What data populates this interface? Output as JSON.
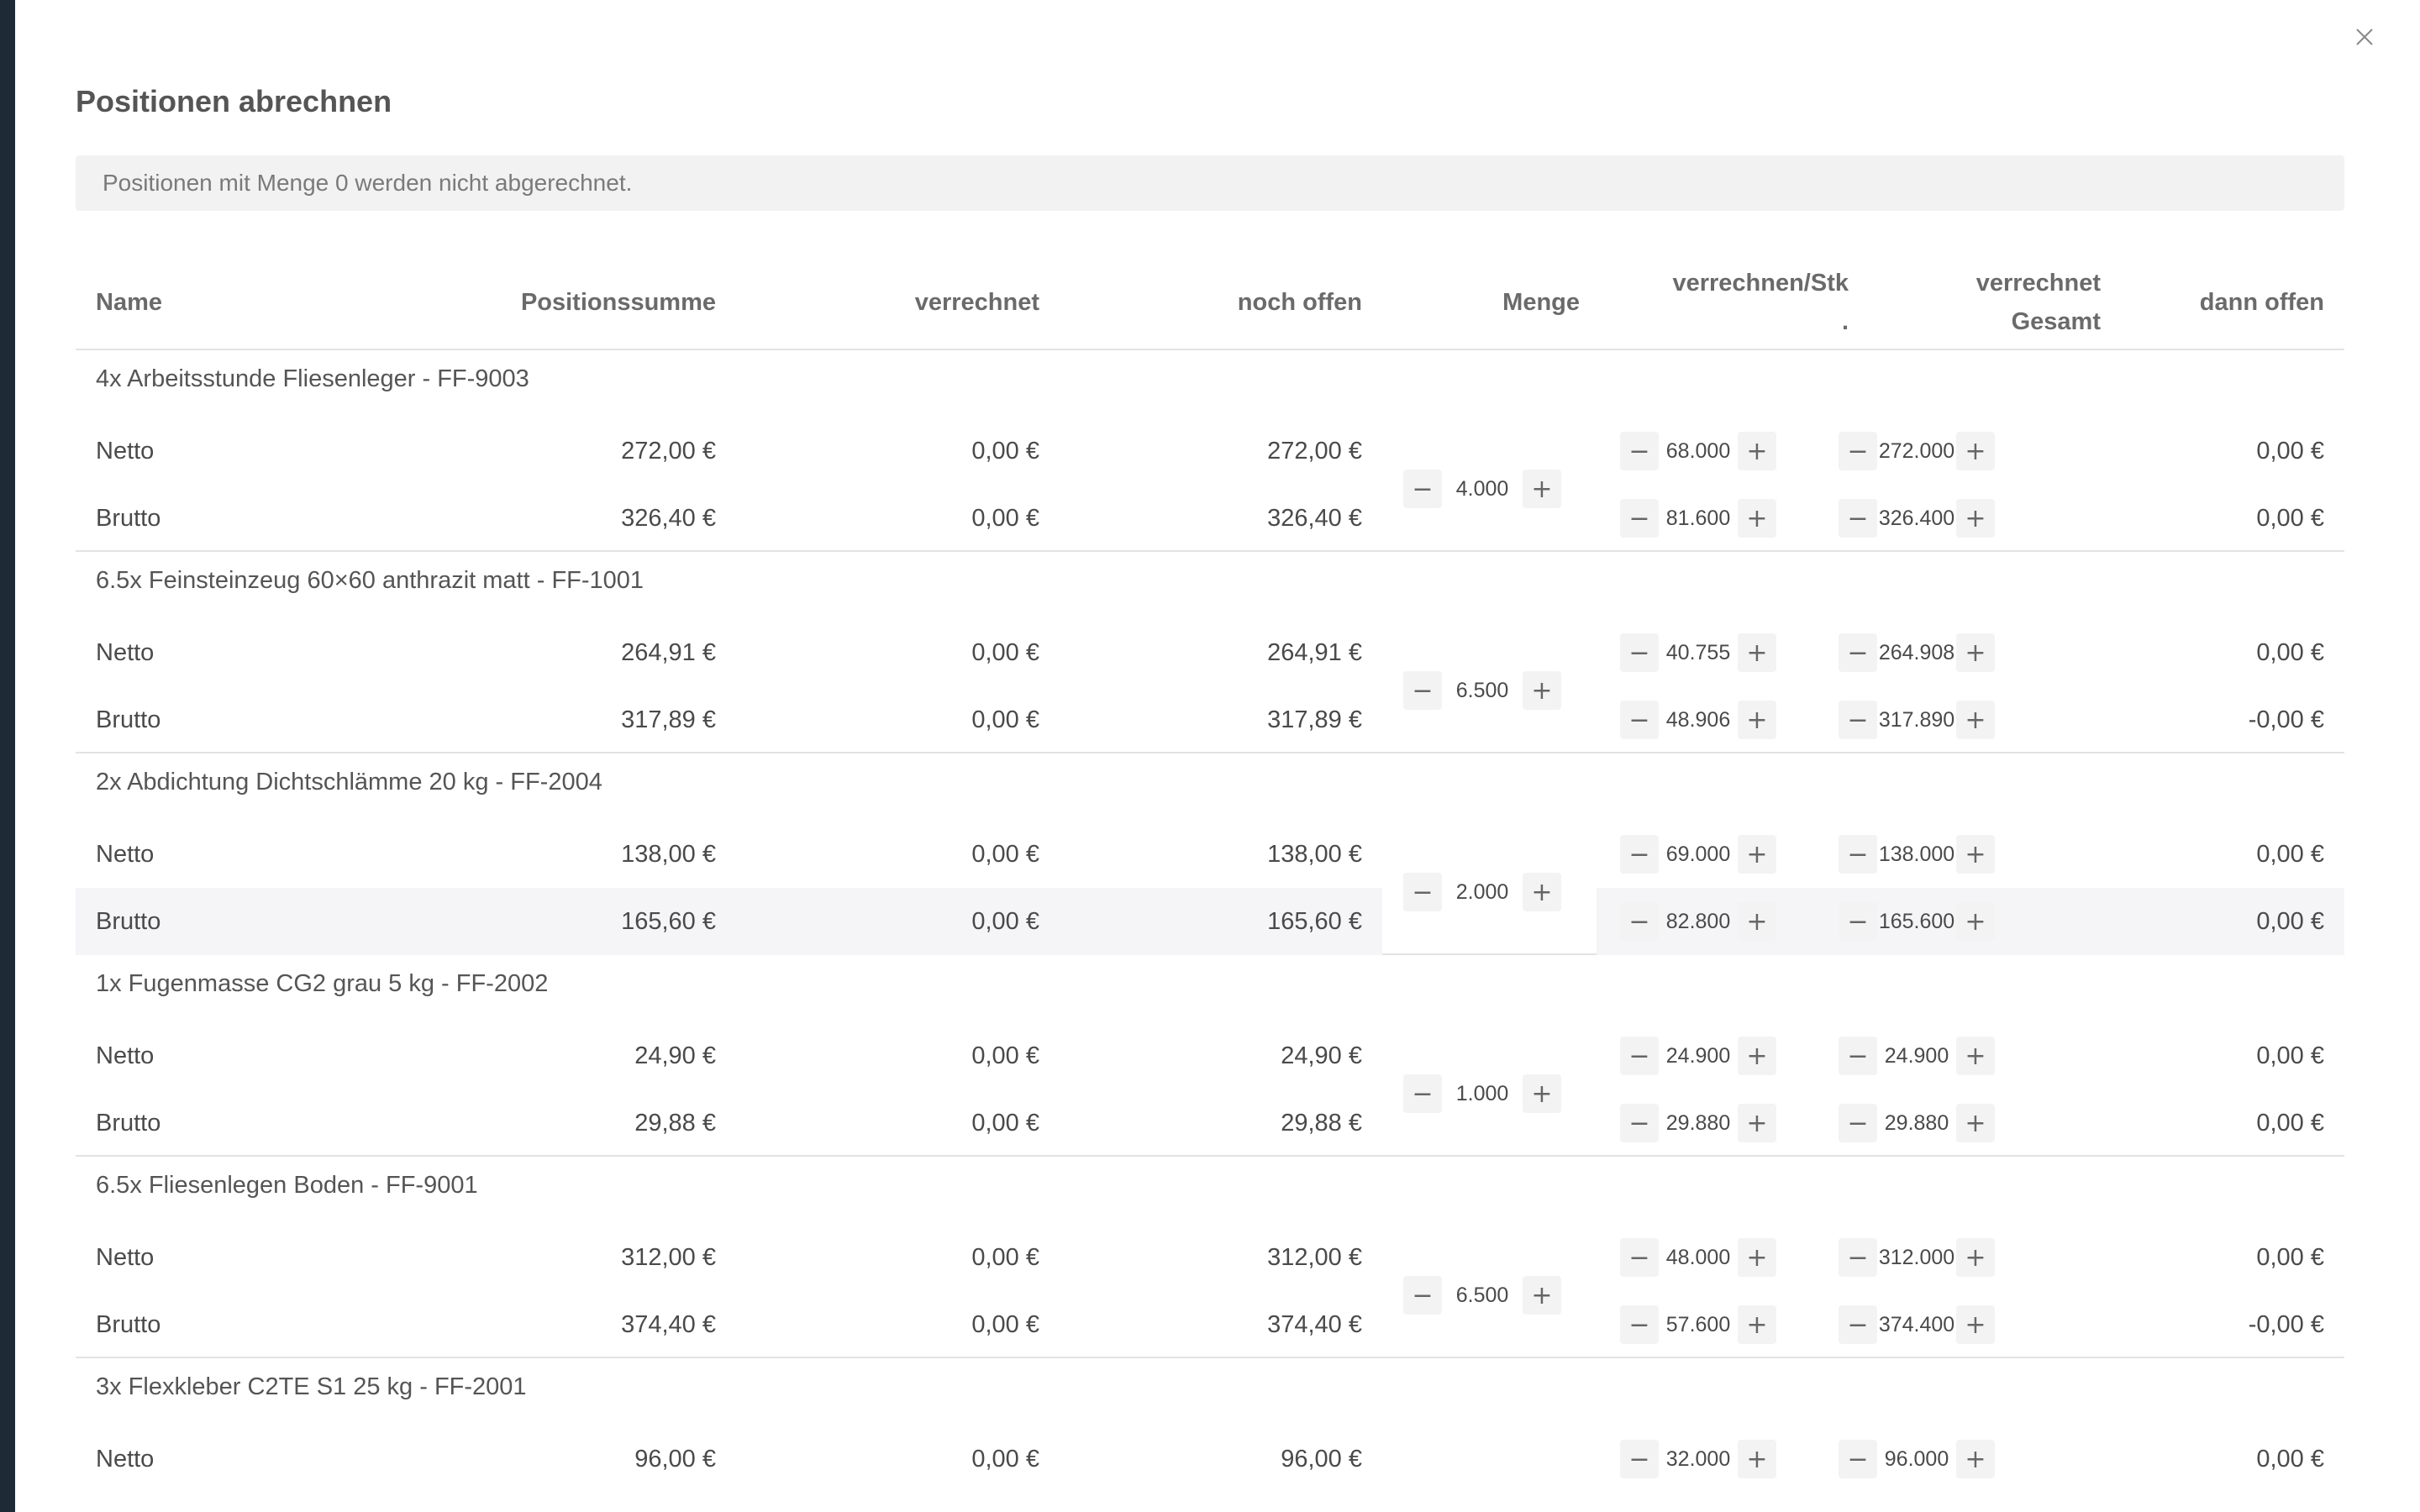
{
  "dialog": {
    "title": "Positionen abrechnen",
    "notice": "Positionen mit Menge 0 werden nicht abgerechnet.",
    "close_icon": "close-icon"
  },
  "table": {
    "headers": {
      "name": "Name",
      "positionssumme": "Positionssumme",
      "verrechnet": "verrechnet",
      "noch_offen": "noch offen",
      "menge": "Menge",
      "verrechnen_stk_line1": "verrechnen/Stk",
      "verrechnen_stk_line2": ".",
      "verrechnet_gesamt_line1": "verrechnet",
      "verrechnet_gesamt_line2": "Gesamt",
      "dann_offen": "dann offen"
    },
    "groups": [
      {
        "title": "4x Arbeitsstunde Fliesenleger - FF-9003",
        "menge": "4.000",
        "netto": {
          "label": "Netto",
          "positionssumme": "272,00 €",
          "verrechnet": "0,00 €",
          "noch_offen": "272,00 €",
          "per_stk": "68.000",
          "gesamt": "272.000",
          "dann_offen": "0,00 €"
        },
        "brutto": {
          "label": "Brutto",
          "positionssumme": "326,40 €",
          "verrechnet": "0,00 €",
          "noch_offen": "326,40 €",
          "per_stk": "81.600",
          "gesamt": "326.400",
          "dann_offen": "0,00 €"
        }
      },
      {
        "title": "6.5x Feinsteinzeug 60×60 anthrazit matt - FF-1001",
        "menge": "6.500",
        "netto": {
          "label": "Netto",
          "positionssumme": "264,91 €",
          "verrechnet": "0,00 €",
          "noch_offen": "264,91 €",
          "per_stk": "40.755",
          "gesamt": "264.908",
          "dann_offen": "0,00 €"
        },
        "brutto": {
          "label": "Brutto",
          "positionssumme": "317,89 €",
          "verrechnet": "0,00 €",
          "noch_offen": "317,89 €",
          "per_stk": "48.906",
          "gesamt": "317.890",
          "dann_offen": "-0,00 €"
        }
      },
      {
        "title": "2x Abdichtung Dichtschlämme 20 kg - FF-2004",
        "menge": "2.000",
        "netto": {
          "label": "Netto",
          "positionssumme": "138,00 €",
          "verrechnet": "0,00 €",
          "noch_offen": "138,00 €",
          "per_stk": "69.000",
          "gesamt": "138.000",
          "dann_offen": "0,00 €"
        },
        "brutto": {
          "label": "Brutto",
          "positionssumme": "165,60 €",
          "verrechnet": "0,00 €",
          "noch_offen": "165,60 €",
          "per_stk": "82.800",
          "gesamt": "165.600",
          "dann_offen": "0,00 €"
        }
      },
      {
        "title": "1x Fugenmasse CG2 grau 5 kg - FF-2002",
        "menge": "1.000",
        "netto": {
          "label": "Netto",
          "positionssumme": "24,90 €",
          "verrechnet": "0,00 €",
          "noch_offen": "24,90 €",
          "per_stk": "24.900",
          "gesamt": "24.900",
          "dann_offen": "0,00 €"
        },
        "brutto": {
          "label": "Brutto",
          "positionssumme": "29,88 €",
          "verrechnet": "0,00 €",
          "noch_offen": "29,88 €",
          "per_stk": "29.880",
          "gesamt": "29.880",
          "dann_offen": "0,00 €"
        }
      },
      {
        "title": "6.5x Fliesenlegen Boden - FF-9001",
        "menge": "6.500",
        "netto": {
          "label": "Netto",
          "positionssumme": "312,00 €",
          "verrechnet": "0,00 €",
          "noch_offen": "312,00 €",
          "per_stk": "48.000",
          "gesamt": "312.000",
          "dann_offen": "0,00 €"
        },
        "brutto": {
          "label": "Brutto",
          "positionssumme": "374,40 €",
          "verrechnet": "0,00 €",
          "noch_offen": "374,40 €",
          "per_stk": "57.600",
          "gesamt": "374.400",
          "dann_offen": "-0,00 €"
        }
      },
      {
        "title": "3x Flexkleber C2TE S1 25 kg - FF-2001",
        "menge": "",
        "netto": {
          "label": "Netto",
          "positionssumme": "96,00 €",
          "verrechnet": "0,00 €",
          "noch_offen": "96,00 €",
          "per_stk": "32.000",
          "gesamt": "96.000",
          "dann_offen": "0,00 €"
        },
        "brutto": {
          "label": "",
          "positionssumme": "",
          "verrechnet": "",
          "noch_offen": "",
          "per_stk": "",
          "gesamt": "",
          "dann_offen": ""
        }
      }
    ]
  },
  "icons": {
    "minus": "−",
    "plus": "+"
  }
}
